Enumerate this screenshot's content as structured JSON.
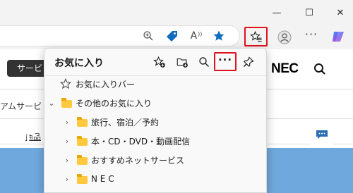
{
  "window": {
    "minimize_glyph": "—",
    "maximize_glyph": "☐",
    "close_glyph": "✕"
  },
  "toolbar": {
    "read_aloud_label": "A",
    "icons": [
      "zoom-icon",
      "tag-icon",
      "read-aloud-icon",
      "favorite-star-icon",
      "favorites-icon",
      "profile-icon",
      "more-tools-icon",
      "copilot-icon"
    ]
  },
  "page": {
    "pill_text": "サービ",
    "logo_text": "NEC",
    "line1_text": "アムサービ",
    "line2_text": "商品",
    "banner_text": "ート情",
    "chat_label": "チ"
  },
  "favorites_panel": {
    "title": "お気に入り",
    "more_label": "···",
    "items": [
      {
        "label": "お気に入りバー",
        "type": "star",
        "level": 0,
        "expandable": false
      },
      {
        "label": "その他のお気に入り",
        "type": "folder",
        "level": 0,
        "expandable": true,
        "expanded": true
      },
      {
        "label": "旅行、宿泊／予約",
        "type": "folder",
        "level": 1,
        "expandable": true,
        "expanded": false
      },
      {
        "label": "本・CD・DVD・動画配信",
        "type": "folder",
        "level": 1,
        "expandable": true,
        "expanded": false
      },
      {
        "label": "おすすめネットサービス",
        "type": "folder",
        "level": 1,
        "expandable": true,
        "expanded": false
      },
      {
        "label": "N E C",
        "type": "folder",
        "level": 1,
        "expandable": true,
        "expanded": false
      }
    ]
  },
  "colors": {
    "highlight": "#e0121e",
    "folder": "#ffc83d",
    "edge_blue": "#0f6cbd",
    "banner": "#6fa8dc"
  }
}
